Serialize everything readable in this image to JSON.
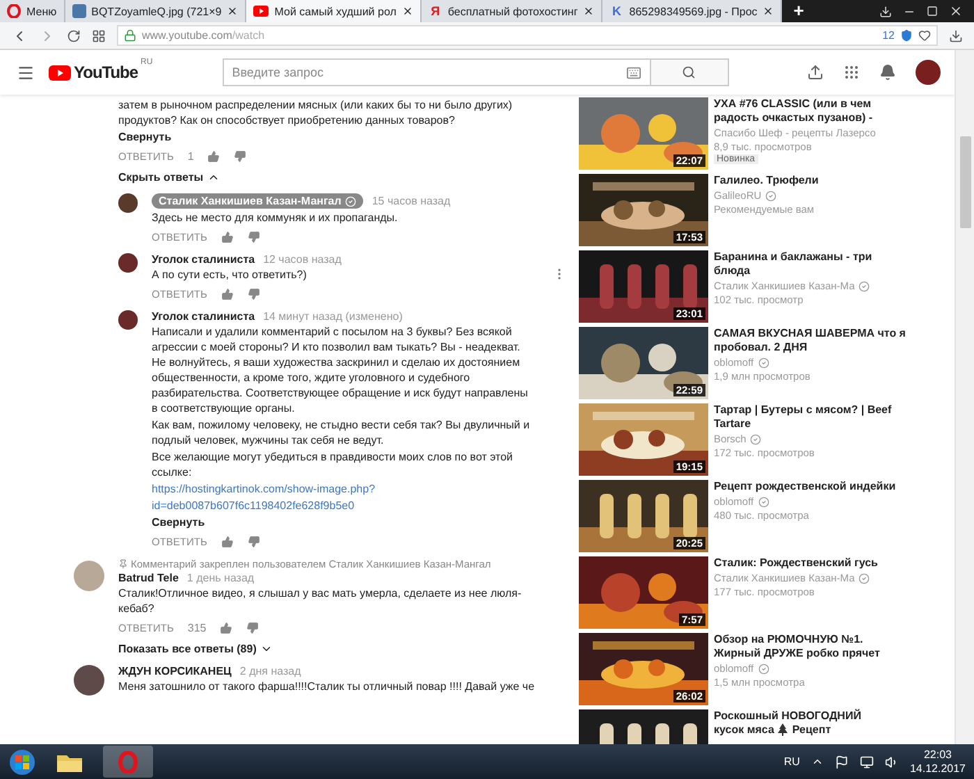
{
  "browser": {
    "tabs": [
      {
        "kind": "menu",
        "label": "Меню",
        "selected": false
      },
      {
        "kind": "vk",
        "label": "BQTZoyamleQ.jpg (721×9",
        "selected": false
      },
      {
        "kind": "youtube",
        "label": "Мой самый худший рол",
        "selected": true
      },
      {
        "kind": "letter",
        "icon_text": "Я",
        "label": "бесплатный фотохостинг",
        "selected": false
      },
      {
        "kind": "letter",
        "icon_text": "K",
        "label": "865298349569.jpg - Прос",
        "selected": false
      }
    ],
    "new_tab": "+",
    "address": {
      "host": "www.youtube.com",
      "path": "/watch"
    },
    "blocked_count": "12"
  },
  "header": {
    "logo": "YouTube",
    "region": "RU",
    "search_placeholder": "Введите запрос"
  },
  "comments": [
    {
      "kind": "fragment",
      "paragraphs": [
        "затем в рыночном распределении мясных (или каких бы то ни было других) продуктов? Как он способствует приобретению данных товаров?"
      ],
      "collapse_label": "Свернуть",
      "reply_label": "ОТВЕТИТЬ",
      "likes": "1",
      "replies_toggle": {
        "label": "Скрыть ответы",
        "expanded": true
      },
      "replies": [
        {
          "author": "Сталик Ханкишиев Казан-Мангал",
          "owner": true,
          "time": "15 часов назад",
          "paragraphs": [
            "Здесь не место для коммуняк и их пропаганды."
          ],
          "reply_label": "ОТВЕТИТЬ",
          "has_menu": false
        },
        {
          "author": "Уголок сталиниста",
          "owner": false,
          "time": "12 часов назад",
          "paragraphs": [
            "А по сути есть, что ответить?)"
          ],
          "reply_label": "ОТВЕТИТЬ",
          "has_menu": true
        },
        {
          "author": "Уголок сталиниста",
          "owner": false,
          "time": "14 минут назад (изменено)",
          "paragraphs": [
            "Написали и удалили комментарий с посылом на 3 буквы? Без всякой агрессии с моей стороны? И кто позволил вам тыкать? Вы - неадекват. Не волнуйтесь, я ваши художества заскринил и сделаю их достоянием общественности, а кроме того, ждите уголовного и судебного разбирательства. Соответствующее обращение и иск будут направлены в соответствующие органы.",
            "Как вам, пожилому человеку, не стыдно вести себя так? Вы двуличный и подлый человек, мужчины так себя не ведут.",
            "Все желающие могут убедиться в правдивости моих слов по вот этой ссылке:"
          ],
          "link": [
            "https://hostingkartinok.com/show-image.php?",
            "id=deb0087b607f6c1198402fe628f9b5e0"
          ],
          "collapse_label": "Свернуть",
          "reply_label": "ОТВЕТИТЬ",
          "has_menu": false
        }
      ]
    },
    {
      "kind": "comment",
      "pinned_note": "Комментарий закреплен пользователем Сталик Ханкишиев Казан-Мангал",
      "author": "Batrud Tele",
      "owner": false,
      "time": "1 день назад",
      "paragraphs": [
        "Сталик!Отличное видео, я слышал у вас мать умерла, сделаете из нее люля-кебаб?"
      ],
      "reply_label": "ОТВЕТИТЬ",
      "likes": "315",
      "replies_toggle": {
        "label": "Показать все ответы (89)",
        "expanded": false
      }
    },
    {
      "kind": "comment",
      "author": "ЖДУН КОРСИКАНЕЦ",
      "owner": false,
      "time": "2 дня назад",
      "paragraphs": [
        "Меня затошнило от такого фарша!!!!Сталик ты отличный повар !!!! Давай уже че"
      ]
    }
  ],
  "sidebar": [
    {
      "title": "УХА #76 CLASSIC (или в чем радость очкастых пузанов) -",
      "channel": "Спасибо Шеф - рецепты Лазерсо",
      "verified": false,
      "meta": "8,9 тыс. просмотров",
      "badge": "Новинка",
      "duration": "22:07"
    },
    {
      "title": "Галилео. Трюфели",
      "channel": "GalileoRU",
      "verified": true,
      "meta": "Рекомендуемые вам",
      "duration": "17:53"
    },
    {
      "title": "Баранина и баклажаны - три блюда",
      "channel": "Сталик Ханкишиев Казан-Ма",
      "verified": true,
      "meta": "102 тыс. просмотр",
      "duration": "23:01"
    },
    {
      "title": "САМАЯ ВКУСНАЯ ШАВЕРМА что я пробовал. 2 ДНЯ",
      "channel": "oblomoff",
      "verified": true,
      "meta": "1,9 млн просмотров",
      "duration": "22:59"
    },
    {
      "title": "Тартар | Бутеры с мясом? | Beef Tartare",
      "channel": "Borsch",
      "verified": true,
      "meta": "172 тыс. просмотров",
      "duration": "19:15"
    },
    {
      "title": "Рецепт рождественской индейки",
      "channel": "oblomoff",
      "verified": true,
      "meta": "480 тыс. просмотра",
      "duration": "20:25"
    },
    {
      "title": "Сталик: Рождественский гусь",
      "channel": "Сталик Ханкишиев Казан-Ма",
      "verified": true,
      "meta": "177 тыс. просмотров",
      "duration": "7:57"
    },
    {
      "title": "Обзор на РЮМОЧНУЮ №1. Жирный ДРУЖЕ робко прячет",
      "channel": "oblomoff",
      "verified": true,
      "meta": "1,5 млн просмотра",
      "duration": "26:02"
    },
    {
      "title": "Роскошный НОВОГОДНИЙ",
      "title_line2": "кусок мяса",
      "title_after_icon": "Рецепт"
    }
  ],
  "taskbar": {
    "language": "RU",
    "time": "22:03",
    "date": "14.12.2017"
  }
}
